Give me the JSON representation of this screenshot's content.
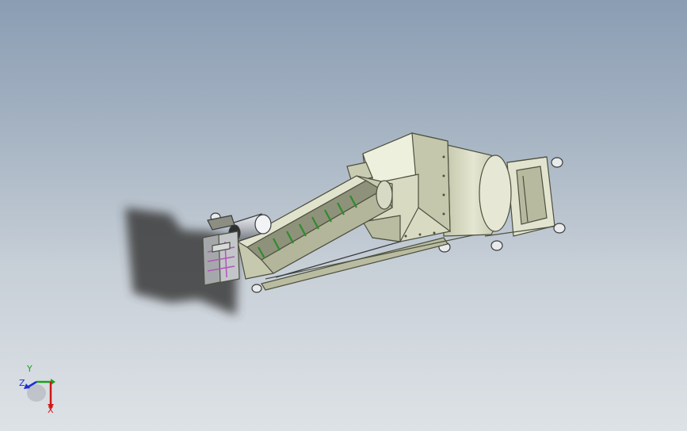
{
  "viewport": {
    "background_top": "#8a9db3",
    "background_bottom": "#dde2e6"
  },
  "model": {
    "body_color": "#d8dbc2",
    "body_shade": "#b9bca0",
    "edge_color": "#4d503f",
    "slat_color": "#2e8b2e",
    "motor_color": "#c9ccd0",
    "panel_accent": "#b256b8",
    "shadow_color": "#3a3a3a"
  },
  "triad": {
    "x_label": "X",
    "y_label": "Y",
    "z_label": "Z",
    "x_color": "#d01515",
    "y_color": "#1aa01a",
    "z_color": "#1b2fd6"
  }
}
